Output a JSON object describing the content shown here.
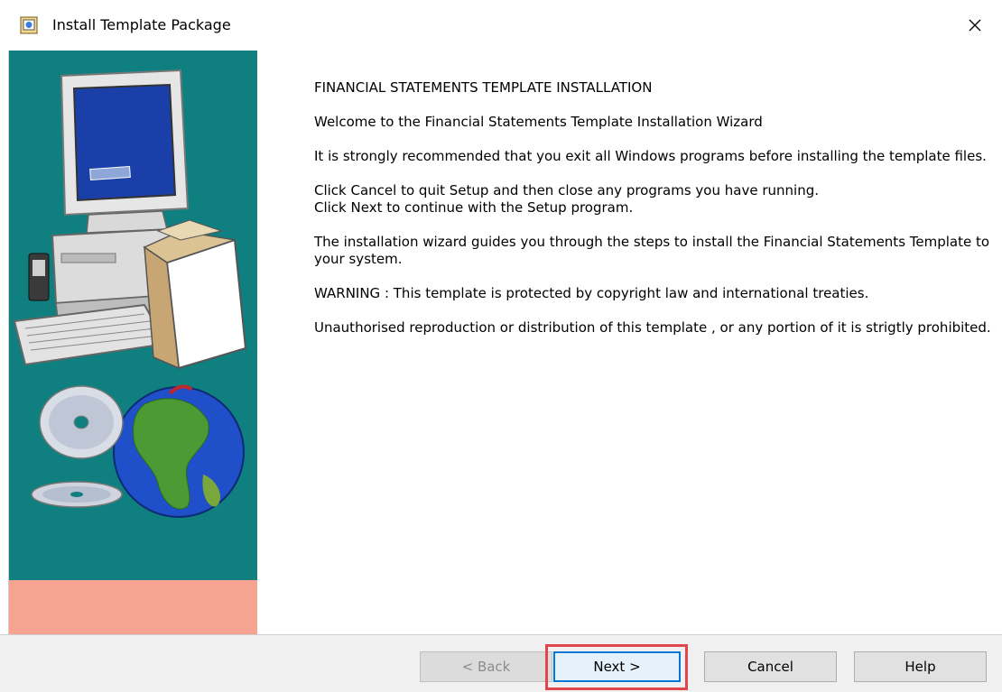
{
  "window": {
    "title": "Install Template Package",
    "close_glyph": "✕",
    "icon": "app-icon"
  },
  "content": {
    "heading": "FINANCIAL STATEMENTS TEMPLATE INSTALLATION",
    "welcome": "Welcome to the Financial Statements Template Installation Wizard",
    "recommend": "It is strongly recommended that you exit all Windows programs before installing the template files.",
    "cancel_line": "Click Cancel to quit Setup and then close any programs you have running.",
    "next_line": "Click Next to continue with the Setup program.",
    "guide": "The installation wizard guides you through the steps to install the Financial Statements Template to your system.",
    "warning": "WARNING : This template is protected by copyright law and international treaties.",
    "unauthorised": "Unauthorised reproduction or distribution of this template , or any portion of it is strigtly prohibited."
  },
  "buttons": {
    "back": "< Back",
    "next": "Next >",
    "cancel": "Cancel",
    "help": "Help"
  },
  "colors": {
    "side_panel_teal": "#0f7f7f",
    "side_panel_salmon": "#f7a392",
    "highlight_red": "#e0474c",
    "default_button_blue": "#0078d7"
  },
  "icons": [
    "computer-illustration",
    "cd-disc-icon",
    "globe-icon",
    "software-box-icon"
  ]
}
